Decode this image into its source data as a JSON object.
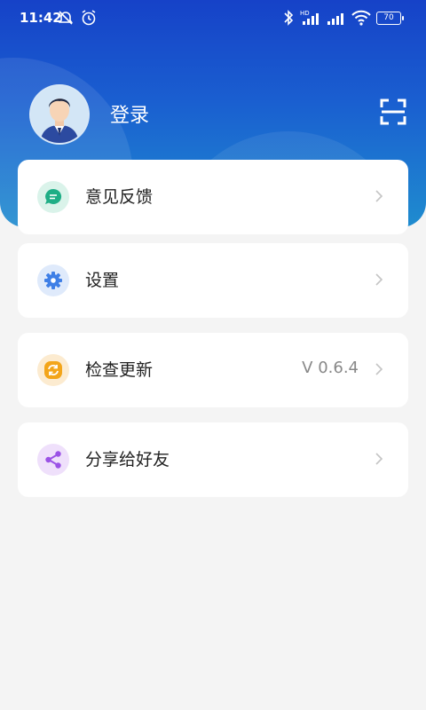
{
  "status_bar": {
    "time": "11:42",
    "battery": "70"
  },
  "profile": {
    "login_label": "登录"
  },
  "menu": {
    "feedback_label": "意见反馈",
    "settings_label": "设置",
    "update_label": "检查更新",
    "version": "V 0.6.4",
    "share_label": "分享给好友"
  },
  "colors": {
    "header_top": "#1642c8",
    "header_bottom": "#1f8ccf",
    "feedback_icon": "#1fae86",
    "settings_icon": "#3f7fe6",
    "update_icon": "#f3a51a",
    "share_icon": "#9b52e6"
  },
  "icons": [
    "scan-icon",
    "message-icon",
    "gear-icon",
    "refresh-icon",
    "share-icon",
    "chevron-right-icon"
  ]
}
